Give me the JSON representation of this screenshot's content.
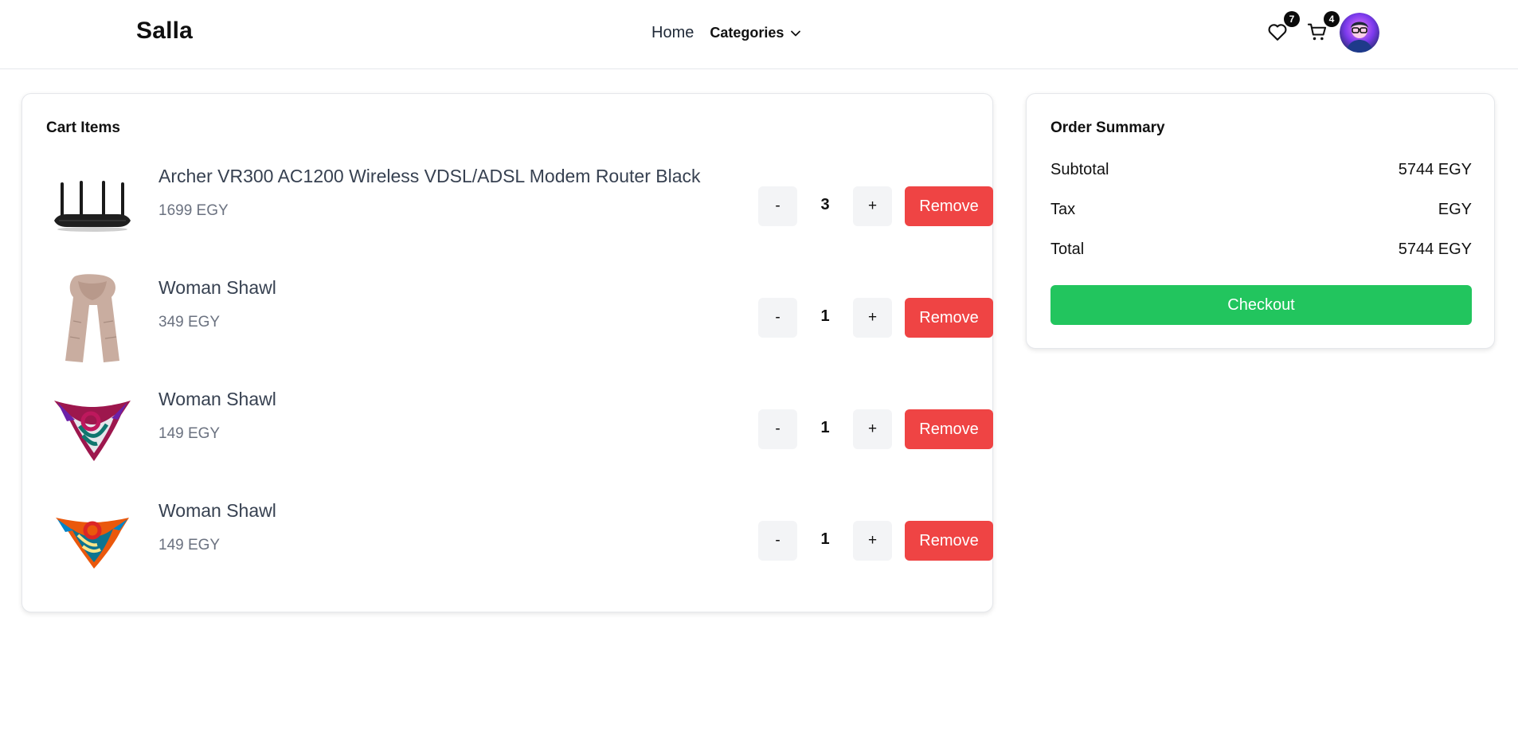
{
  "header": {
    "brand": "Salla",
    "nav": {
      "home": "Home",
      "categories": "Categories"
    },
    "wishlist_count": "7",
    "cart_count": "4"
  },
  "cart": {
    "title": "Cart Items",
    "items": [
      {
        "name": "Archer VR300 AC1200 Wireless VDSL/ADSL Modem Router Black",
        "price": "1699 EGY",
        "qty": "3",
        "image": "router-image"
      },
      {
        "name": "Woman Shawl",
        "price": "349 EGY",
        "qty": "1",
        "image": "beige-shawl-image"
      },
      {
        "name": "Woman Shawl",
        "price": "149 EGY",
        "qty": "1",
        "image": "pink-scarf-image"
      },
      {
        "name": "Woman Shawl",
        "price": "149 EGY",
        "qty": "1",
        "image": "orange-scarf-image"
      }
    ],
    "minus_label": "-",
    "plus_label": "+",
    "remove_label": "Remove"
  },
  "summary": {
    "title": "Order Summary",
    "subtotal_label": "Subtotal",
    "subtotal_value": "5744 EGY",
    "tax_label": "Tax",
    "tax_value": "EGY",
    "total_label": "Total",
    "total_value": "5744 EGY",
    "checkout_label": "Checkout"
  },
  "colors": {
    "remove": "#ef4444",
    "checkout": "#22c55e",
    "step_bg": "#f3f4f6"
  }
}
